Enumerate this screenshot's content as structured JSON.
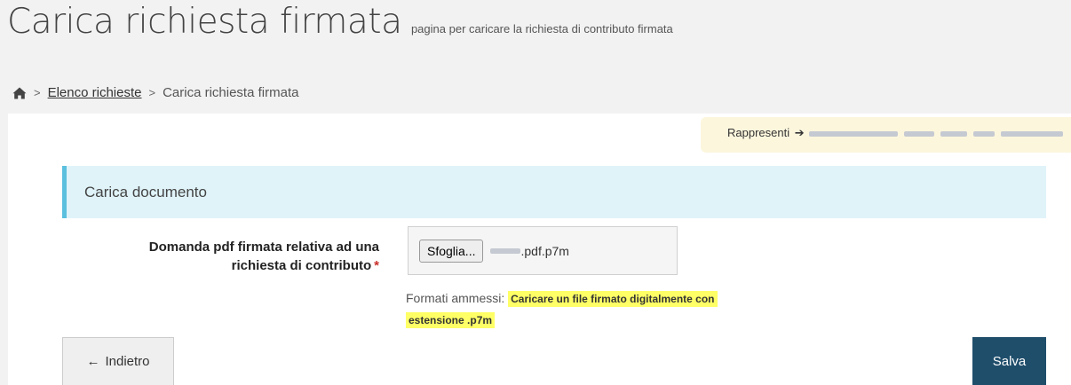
{
  "header": {
    "title": "Carica richiesta firmata",
    "subtitle": "pagina per caricare la richiesta di contributo firmata"
  },
  "breadcrumb": {
    "home_icon": "home-icon",
    "items": [
      "Elenco richieste",
      "Carica richiesta firmata"
    ]
  },
  "rappresenti": {
    "label": "Rappresenti"
  },
  "section": {
    "title": "Carica documento"
  },
  "form": {
    "label_line1": "Domanda pdf firmata relativa ad una",
    "label_line2": "richiesta di contributo",
    "required_mark": "*",
    "browse_label": "Sfoglia...",
    "file_ext": ".pdf.p7m",
    "help_prefix": "Formati ammessi:",
    "help_highlight_line1": "Caricare un file firmato digitalmente con",
    "help_highlight_line2": "estensione .p7m"
  },
  "actions": {
    "back_label": "Indietro",
    "save_label": "Salva"
  },
  "colors": {
    "accent": "#5bc0de",
    "save_bg": "#1f4e6b",
    "highlight": "#ffff66",
    "required": "#c9302c"
  }
}
